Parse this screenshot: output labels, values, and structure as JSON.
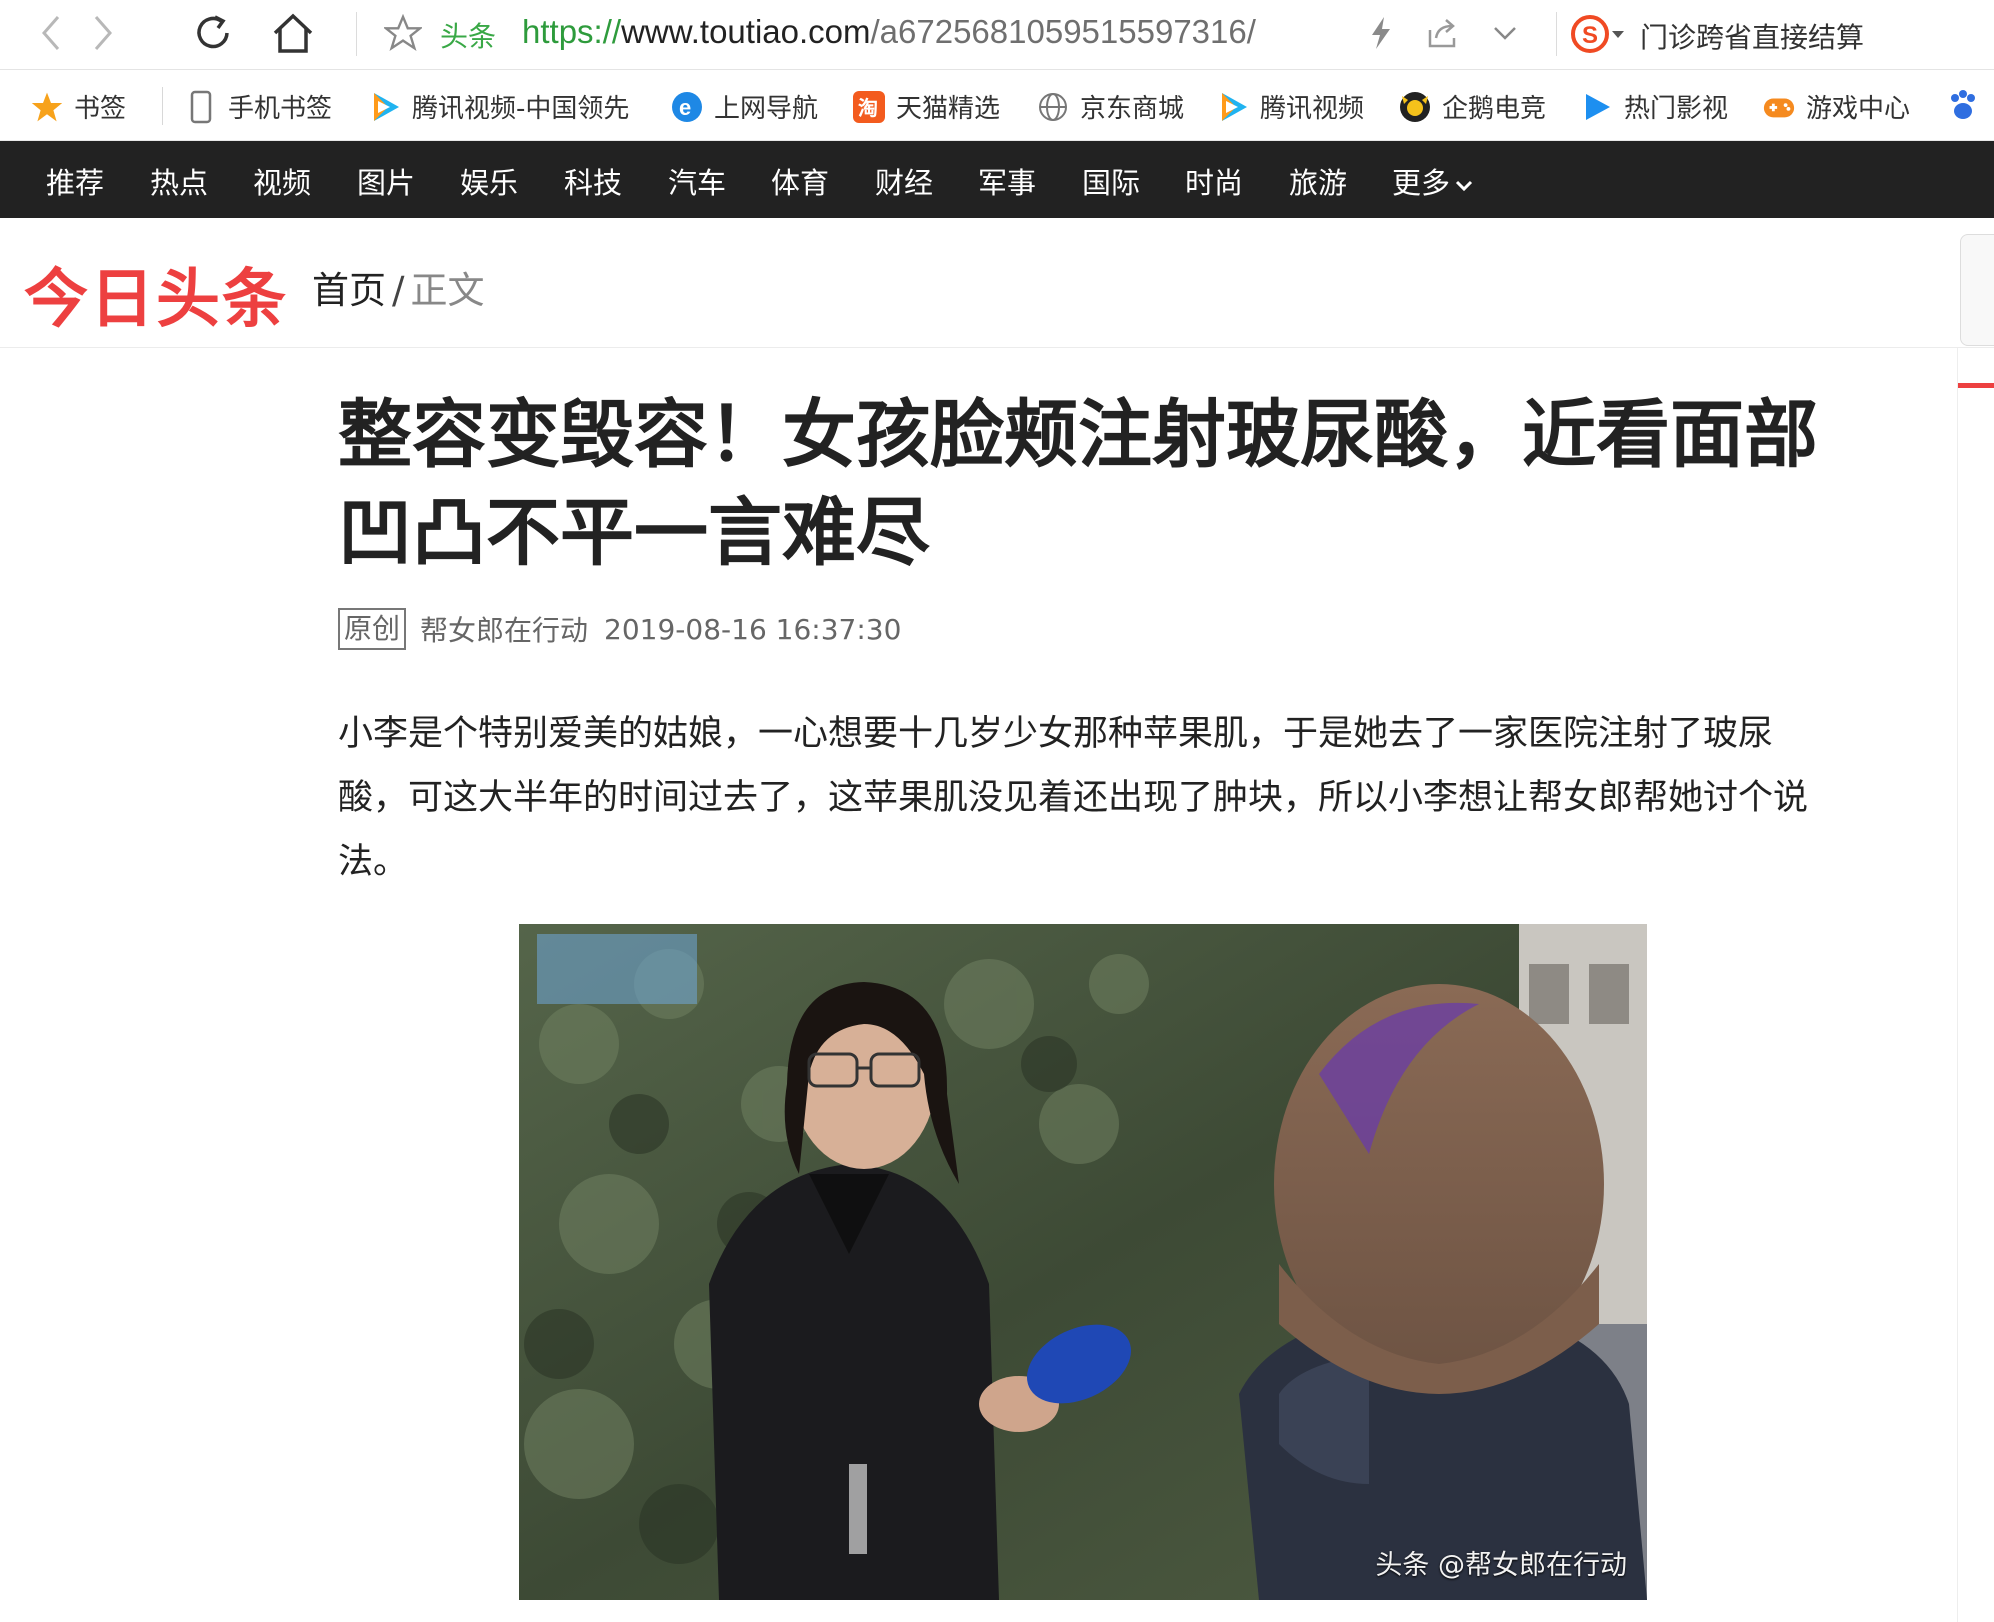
{
  "browser": {
    "site_tag": "头条",
    "url": {
      "protocol": "https://",
      "domain": "www.toutiao.com",
      "path": "/a6725681059515597316/"
    },
    "search_text": "门诊跨省直接结算"
  },
  "bookmarks": [
    {
      "label": "书签",
      "icon": "star-icon"
    },
    {
      "label": "手机书签",
      "icon": "phone-icon"
    },
    {
      "label": "腾讯视频-中国领先",
      "icon": "tencent-video-icon"
    },
    {
      "label": "上网导航",
      "icon": "ie-icon"
    },
    {
      "label": "天猫精选",
      "icon": "tmall-icon"
    },
    {
      "label": "京东商城",
      "icon": "globe-icon"
    },
    {
      "label": "腾讯视频",
      "icon": "tencent-video-icon"
    },
    {
      "label": "企鹅电竞",
      "icon": "penguin-esports-icon"
    },
    {
      "label": "热门影视",
      "icon": "play-icon"
    },
    {
      "label": "游戏中心",
      "icon": "gamepad-icon"
    }
  ],
  "channels": [
    "推荐",
    "热点",
    "视频",
    "图片",
    "娱乐",
    "科技",
    "汽车",
    "体育",
    "财经",
    "军事",
    "国际",
    "时尚",
    "旅游",
    "更多"
  ],
  "header": {
    "logo": "今日头条",
    "breadcrumb_home": "首页",
    "breadcrumb_sep": "/",
    "breadcrumb_current": "正文"
  },
  "article": {
    "title": "整容变毁容！女孩脸颊注射玻尿酸，近看面部凹凸不平一言难尽",
    "badge": "原创",
    "source": "帮女郎在行动",
    "datetime": "2019-08-16 16:37:30",
    "body": "小李是个特别爱美的姑娘，一心想要十几岁少女那种苹果肌，于是她去了一家医院注射了玻尿酸，可这大半年的时间过去了，这苹果肌没见着还出现了肿块，所以小李想让帮女郎帮她讨个说法。",
    "image_watermark": "头条 @帮女郎在行动"
  },
  "colors": {
    "brand_red": "#ed4040",
    "nav_bg": "#222222",
    "url_green": "#2e9b3c"
  }
}
